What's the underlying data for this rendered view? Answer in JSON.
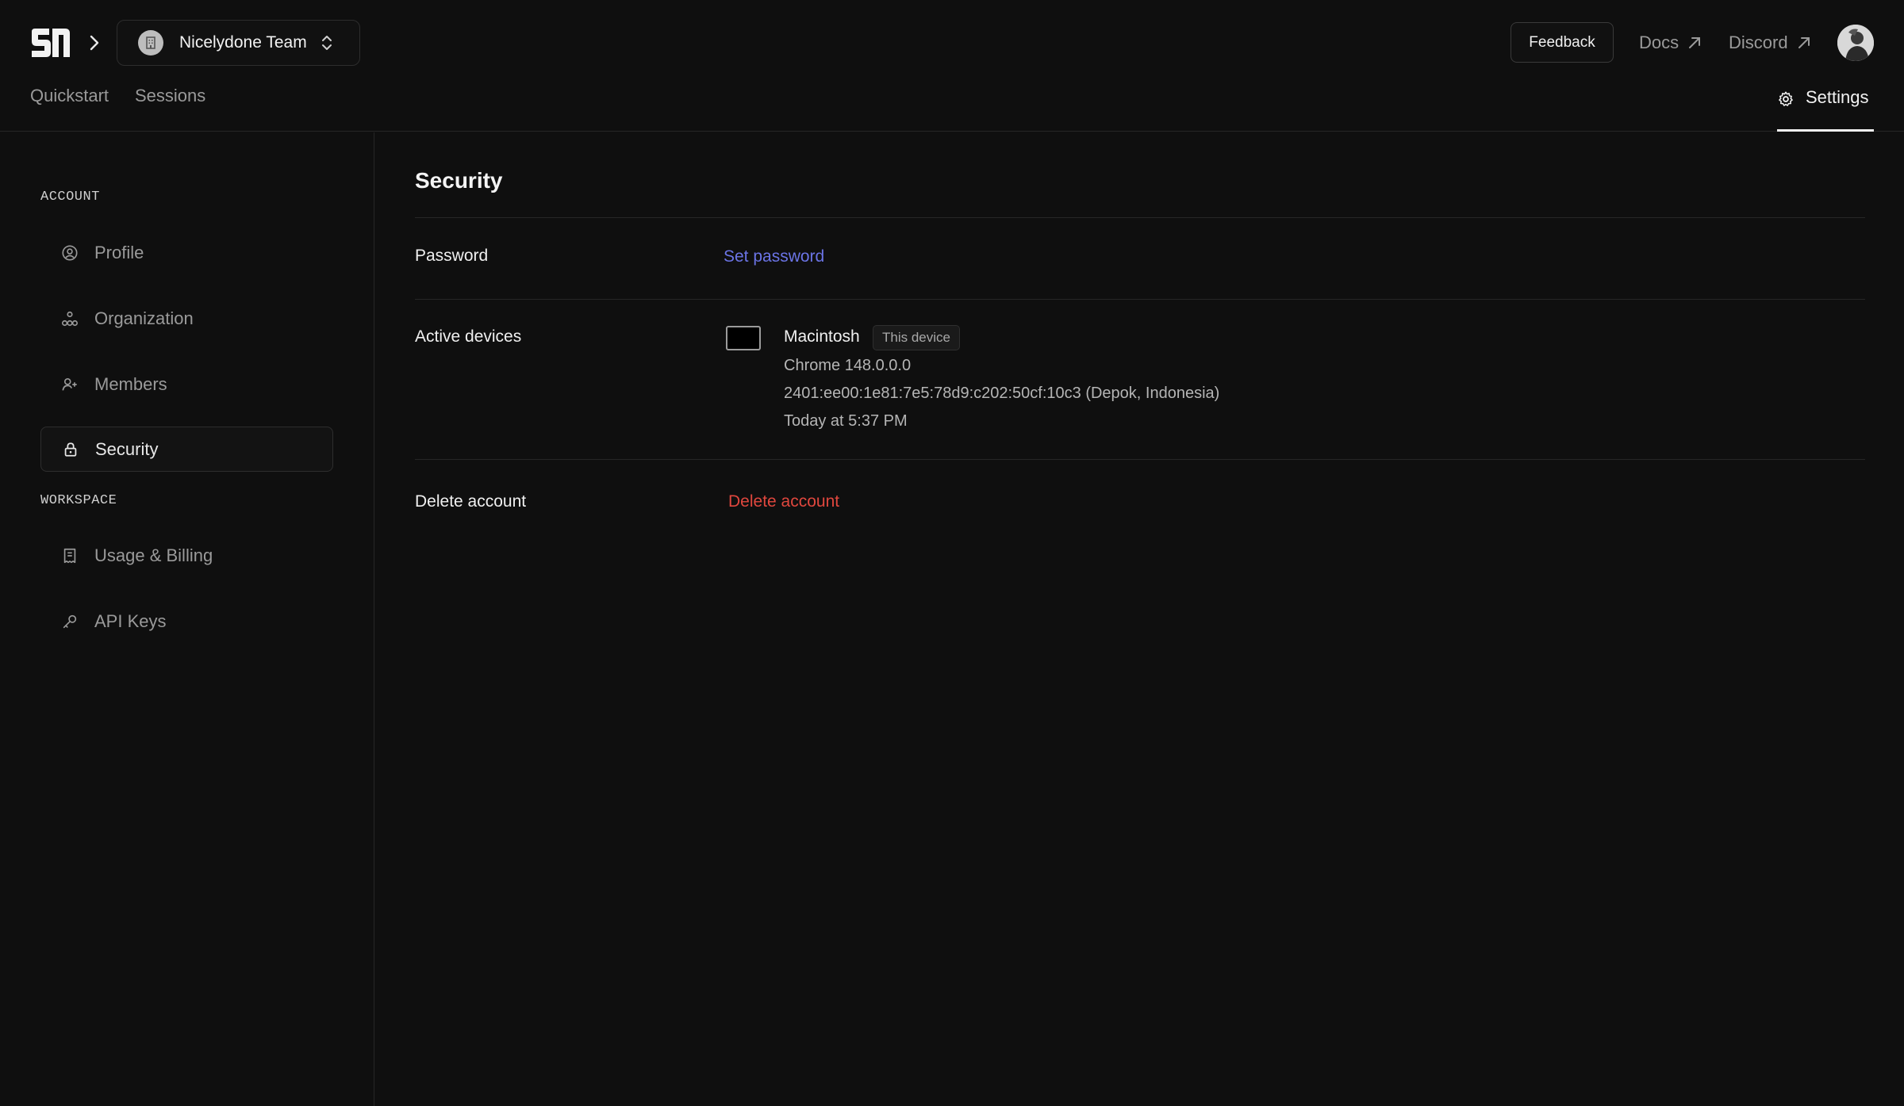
{
  "header": {
    "team_name": "Nicelydone Team",
    "feedback_label": "Feedback",
    "docs_label": "Docs",
    "discord_label": "Discord"
  },
  "tabs": {
    "quickstart": "Quickstart",
    "sessions": "Sessions",
    "settings": "Settings"
  },
  "sidebar": {
    "account_title": "ACCOUNT",
    "workspace_title": "WORKSPACE",
    "items": [
      {
        "label": "Profile",
        "icon": "user-circle-icon"
      },
      {
        "label": "Organization",
        "icon": "organization-icon"
      },
      {
        "label": "Members",
        "icon": "user-plus-icon"
      },
      {
        "label": "Security",
        "icon": "lock-icon",
        "active": true
      },
      {
        "label": "Usage & Billing",
        "icon": "receipt-icon"
      },
      {
        "label": "API Keys",
        "icon": "key-icon"
      }
    ]
  },
  "main": {
    "title": "Security",
    "password_label": "Password",
    "set_password_label": "Set password",
    "active_devices_label": "Active devices",
    "device": {
      "name": "Macintosh",
      "badge": "This device",
      "browser": "Chrome 148.0.0.0",
      "ip_location": "2401:ee00:1e81:7e5:78d9:c202:50cf:10c3 (Depok, Indonesia)",
      "last_seen": "Today at 5:37 PM"
    },
    "delete_account_label": "Delete account",
    "delete_account_action": "Delete account"
  },
  "colors": {
    "background": "#0f0f0f",
    "link_blue": "#6b74e6",
    "danger_red": "#e0473e"
  }
}
